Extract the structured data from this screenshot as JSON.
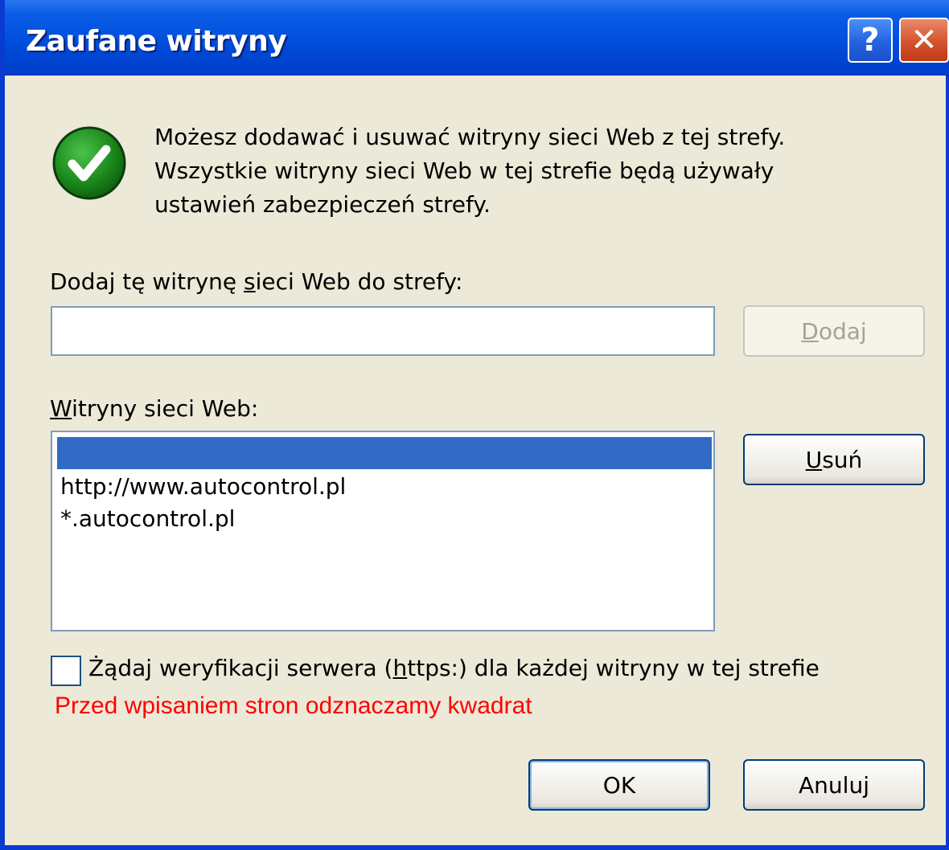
{
  "window": {
    "title": "Zaufane witryny",
    "help_glyph": "?",
    "close_glyph": "✕"
  },
  "info": {
    "icon": "green-checkmark-icon",
    "lines": [
      "Możesz dodawać i usuwać witryny sieci Web z tej strefy.",
      "Wszystkie witryny sieci Web w tej strefie będą używały",
      "ustawień zabezpieczeń strefy."
    ]
  },
  "add_site": {
    "label_before": "Dodaj tę witrynę ",
    "label_accel": "s",
    "label_after": "ieci Web do strefy:",
    "input_value": "",
    "button_accel": "D",
    "button_rest": "odaj"
  },
  "sites": {
    "label_accel": "W",
    "label_rest": "itryny sieci Web:",
    "items": [
      "",
      "http://www.autocontrol.pl",
      "*.autocontrol.pl"
    ],
    "remove_accel": "U",
    "remove_rest": "suń"
  },
  "https_check": {
    "checked": false,
    "label_before": "Żądaj weryfikacji serwera (",
    "label_accel": "h",
    "label_after": "ttps:) dla każdej witryny w tej strefie"
  },
  "note": "Przed wpisaniem stron odznaczamy kwadrat",
  "buttons": {
    "ok": "OK",
    "cancel": "Anuluj"
  },
  "colors": {
    "titlebar": "#0453e0",
    "selection": "#316ac5",
    "note": "#ff0000",
    "dialog_bg": "#ece9d8"
  }
}
